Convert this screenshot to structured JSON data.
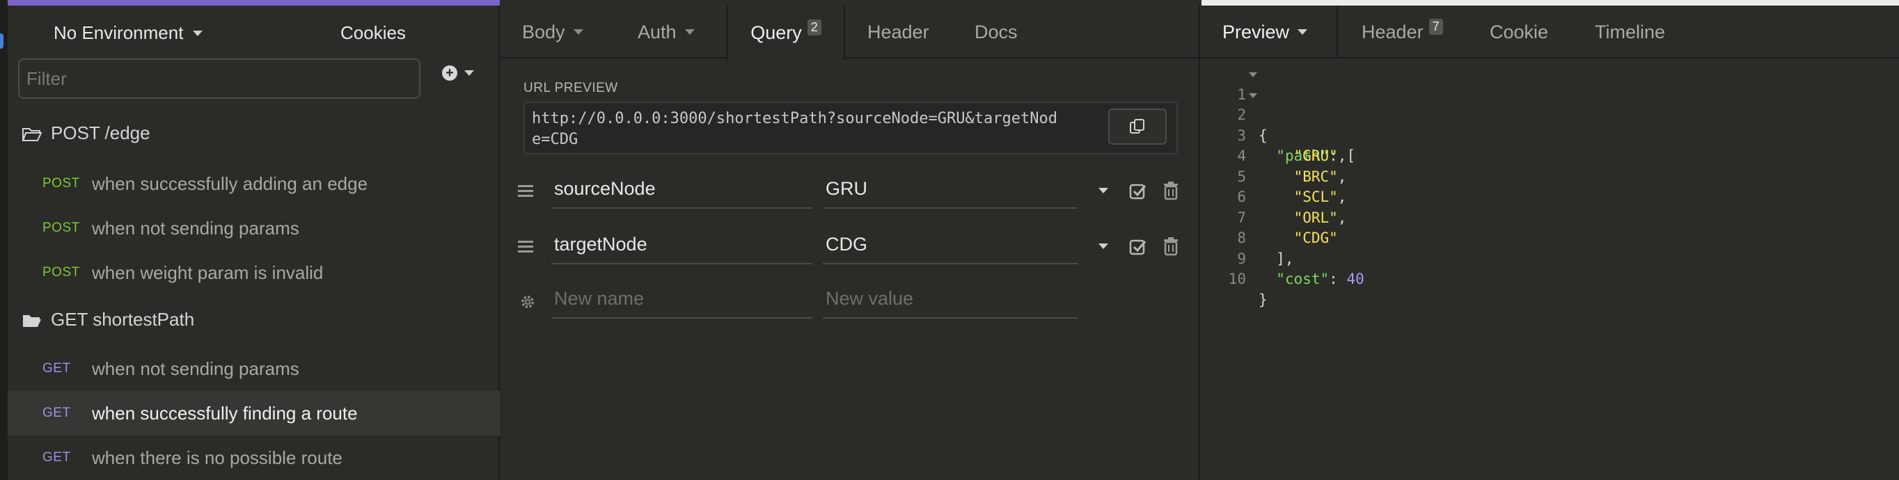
{
  "sidebar": {
    "environment": "No Environment",
    "cookies": "Cookies",
    "filter_placeholder": "Filter",
    "folders": [
      {
        "name": "POST /edge",
        "requests": [
          {
            "method": "POST",
            "label": "when successfully adding an edge"
          },
          {
            "method": "POST",
            "label": "when not sending params"
          },
          {
            "method": "POST",
            "label": "when weight param is invalid"
          }
        ]
      },
      {
        "name": "GET shortestPath",
        "requests": [
          {
            "method": "GET",
            "label": "when not sending params"
          },
          {
            "method": "GET",
            "label": "when successfully finding a route",
            "active": true
          },
          {
            "method": "GET",
            "label": "when there is no possible route"
          }
        ]
      }
    ]
  },
  "request": {
    "tabs": {
      "body": "Body",
      "auth": "Auth",
      "query": "Query",
      "query_count": "2",
      "header": "Header",
      "docs": "Docs"
    },
    "url_preview_label": "URL PREVIEW",
    "url_line1": "http://0.0.0.0:3000/shortestPath?sourceNode=GRU&targetNod",
    "url_line2": "e=CDG",
    "params": [
      {
        "name": "sourceNode",
        "value": "GRU"
      },
      {
        "name": "targetNode",
        "value": "CDG"
      }
    ],
    "new_name_placeholder": "New name",
    "new_value_placeholder": "New value"
  },
  "response": {
    "tabs": {
      "preview": "Preview",
      "header": "Header",
      "header_count": "7",
      "cookie": "Cookie",
      "timeline": "Timeline"
    },
    "lines": [
      "1",
      "2",
      "3",
      "4",
      "5",
      "6",
      "7",
      "8",
      "9",
      "10"
    ],
    "path_key": "\"path\"",
    "path_values": [
      "\"GRU\"",
      "\"BRC\"",
      "\"SCL\"",
      "\"ORL\"",
      "\"CDG\""
    ],
    "cost_key": "\"cost\"",
    "cost_value": "40"
  },
  "colors": {
    "post": "#7dca2f",
    "get": "#9f8ee6",
    "accent": "#7a63c9",
    "json_key": "#7ed957",
    "json_string": "#f2e35a",
    "json_number": "#a99cf2"
  }
}
